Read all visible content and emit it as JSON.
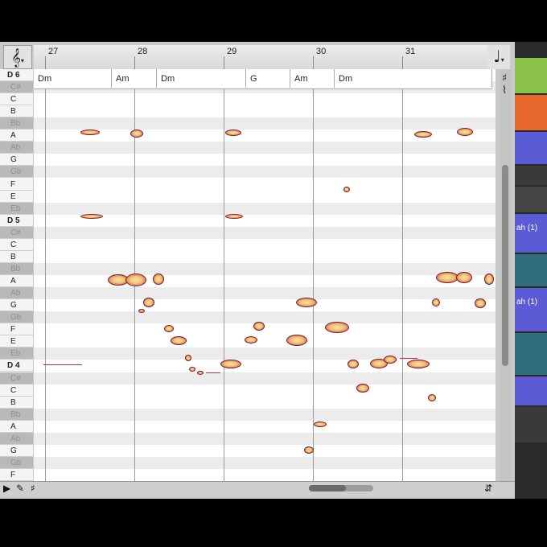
{
  "editor": {
    "clef_symbol": "𝄞",
    "clef_menu": "▾",
    "note_value_symbol": "♩",
    "note_menu": "▾",
    "sharp_symbol": "♯",
    "tuning_symbol": "⌇",
    "bars": [
      "27",
      "28",
      "29",
      "30",
      "31"
    ]
  },
  "keys": [
    "D 6",
    "C#",
    "C",
    "B",
    "Bb",
    "A",
    "Ab",
    "G",
    "Gb",
    "F",
    "E",
    "Eb",
    "D 5",
    "C#",
    "C",
    "B",
    "Bb",
    "A",
    "Ab",
    "G",
    "Gb",
    "F",
    "E",
    "Eb",
    "D 4",
    "C#",
    "C",
    "B",
    "Bb",
    "A",
    "Ab",
    "G",
    "Gb",
    "F"
  ],
  "chords": [
    "Dm",
    "Am",
    "Dm",
    "G",
    "Am",
    "Dm"
  ],
  "tools": {
    "pointer_icon": "▶",
    "pencil_icon": "✎",
    "scale_icon": "♯",
    "zoom_icon": "⇵"
  },
  "tracks": {
    "clip_a": "ah (1)",
    "clip_b": "ah (1)"
  },
  "colors": {
    "blob_fill": "#efc27a",
    "blob_edge": "#b8323e",
    "black_key_row": "#ececec",
    "track_green": "#8bc34a",
    "track_orange": "#e8692e",
    "track_blue": "#5b5bd6",
    "track_teal": "#2f6e7a"
  }
}
